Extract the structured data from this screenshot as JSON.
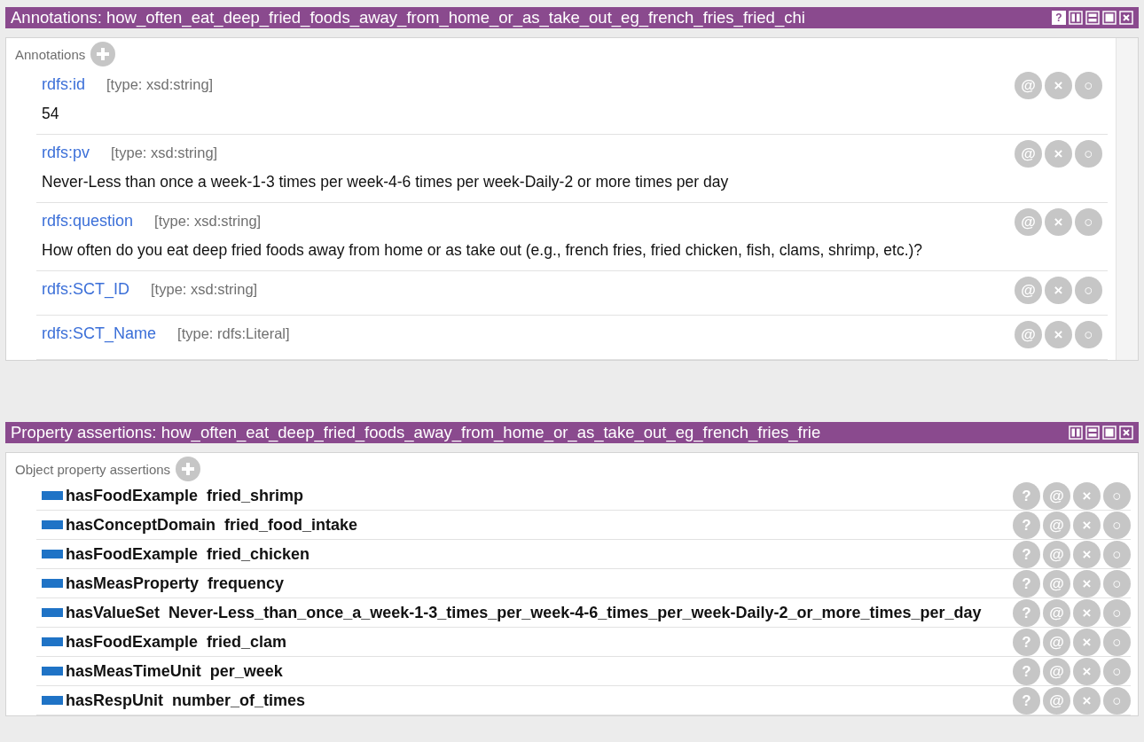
{
  "annotations_panel": {
    "title": "Annotations: how_often_eat_deep_fried_foods_away_from_home_or_as_take_out_eg_french_fries_fried_chi",
    "buttons": [
      {
        "kind": "help",
        "label": "?"
      },
      {
        "kind": "split-v"
      },
      {
        "kind": "split-h"
      },
      {
        "kind": "maximize"
      },
      {
        "kind": "close"
      }
    ],
    "section": "Annotations",
    "rows": [
      {
        "property": "rdfs:id",
        "type": "[type: xsd:string]",
        "value": "54",
        "actions": [
          "@",
          "×",
          "○"
        ]
      },
      {
        "property": "rdfs:pv",
        "type": "[type: xsd:string]",
        "value": "Never-Less than once a week-1-3 times per week-4-6 times per week-Daily-2 or more times per day",
        "actions": [
          "@",
          "×",
          "○"
        ]
      },
      {
        "property": "rdfs:question",
        "type": "[type: xsd:string]",
        "value": "How often do you eat deep fried foods away from home or as take out (e.g., french fries, fried chicken, fish, clams, shrimp, etc.)?",
        "actions": [
          "@",
          "×",
          "○"
        ]
      },
      {
        "property": "rdfs:SCT_ID",
        "type": "[type: xsd:string]",
        "actions": [
          "@",
          "×",
          "○"
        ]
      },
      {
        "property": "rdfs:SCT_Name",
        "type": "[type: rdfs:Literal]",
        "actions": [
          "@",
          "×",
          "○"
        ]
      }
    ]
  },
  "property_panel": {
    "title": "Property assertions: how_often_eat_deep_fried_foods_away_from_home_or_as_take_out_eg_french_fries_frie",
    "buttons": [
      {
        "kind": "split-v"
      },
      {
        "kind": "split-h"
      },
      {
        "kind": "maximize"
      },
      {
        "kind": "close"
      }
    ],
    "section": "Object property assertions",
    "rows": [
      {
        "property": "hasFoodExample",
        "value": "fried_shrimp",
        "actions": [
          "?",
          "@",
          "×",
          "○"
        ]
      },
      {
        "property": "hasConceptDomain",
        "value": "fried_food_intake",
        "actions": [
          "?",
          "@",
          "×",
          "○"
        ]
      },
      {
        "property": "hasFoodExample",
        "value": "fried_chicken",
        "actions": [
          "?",
          "@",
          "×",
          "○"
        ]
      },
      {
        "property": "hasMeasProperty",
        "value": "frequency",
        "actions": [
          "?",
          "@",
          "×",
          "○"
        ]
      },
      {
        "property": "hasValueSet",
        "value": "Never-Less_than_once_a_week-1-3_times_per_week-4-6_times_per_week-Daily-2_or_more_times_per_day",
        "actions": [
          "?",
          "@",
          "×",
          "○"
        ]
      },
      {
        "property": "hasFoodExample",
        "value": "fried_clam",
        "actions": [
          "?",
          "@",
          "×",
          "○"
        ]
      },
      {
        "property": "hasMeasTimeUnit",
        "value": "per_week",
        "actions": [
          "?",
          "@",
          "×",
          "○"
        ]
      },
      {
        "property": "hasRespUnit",
        "value": "number_of_times",
        "actions": [
          "?",
          "@",
          "×",
          "○"
        ]
      }
    ]
  }
}
